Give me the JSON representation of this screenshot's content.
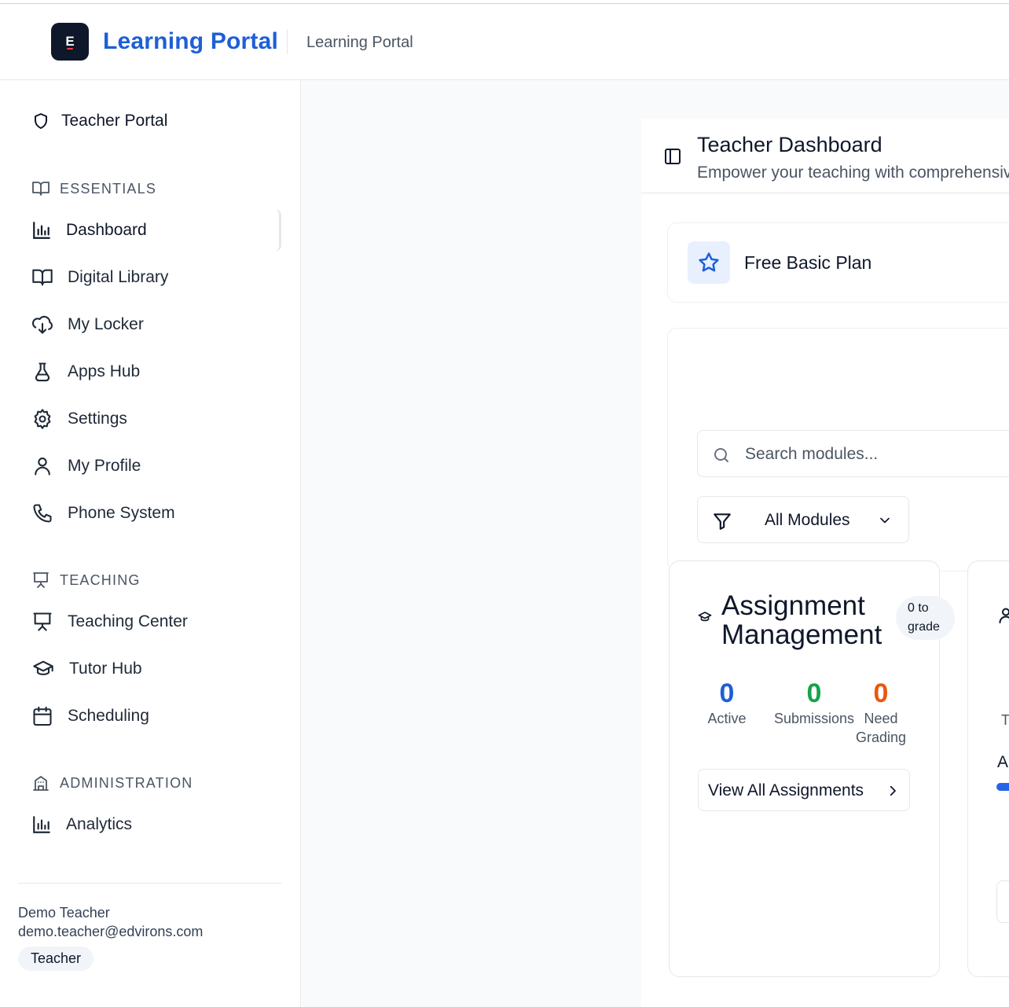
{
  "header": {
    "logo_letter": "E",
    "app_title": "Learning Portal",
    "breadcrumb": "Learning Portal"
  },
  "sidebar": {
    "portal_label": "Teacher Portal",
    "sections": {
      "essentials": "ESSENTIALS",
      "teaching": "TEACHING",
      "administration": "ADMINISTRATION"
    },
    "items": [
      {
        "label": "Dashboard",
        "icon": "bar-chart-icon"
      },
      {
        "label": "Digital Library",
        "icon": "book-open-icon"
      },
      {
        "label": "My Locker",
        "icon": "cloud-download-icon"
      },
      {
        "label": "Apps Hub",
        "icon": "flask-icon"
      },
      {
        "label": "Settings",
        "icon": "gear-icon"
      },
      {
        "label": "My Profile",
        "icon": "user-icon"
      },
      {
        "label": "Phone System",
        "icon": "phone-icon"
      },
      {
        "label": "Teaching Center",
        "icon": "presentation-icon"
      },
      {
        "label": "Tutor Hub",
        "icon": "graduation-cap-icon"
      },
      {
        "label": "Scheduling",
        "icon": "calendar-icon"
      },
      {
        "label": "Analytics",
        "icon": "bar-chart-icon"
      }
    ],
    "user": {
      "name": "Demo Teacher",
      "email": "demo.teacher@edvirons.com",
      "role": "Teacher"
    }
  },
  "panel": {
    "title": "Teacher Dashboard",
    "subtitle": "Empower your teaching with comprehensiv",
    "plan": "Free Basic Plan",
    "search_placeholder": "Search modules...",
    "filter_selected": "All Modules"
  },
  "assignments": {
    "title_line1": "Assignment",
    "title_line2": "Management",
    "badge_line1": "0 to",
    "badge_line2": "grade",
    "stats": [
      {
        "value": "0",
        "label": "Active",
        "color": "#1d5fd8"
      },
      {
        "value": "0",
        "label": "Submissions",
        "color": "#16a34a"
      },
      {
        "value": "0",
        "label_line1": "Need",
        "label_line2": "Grading",
        "color": "#ea580c"
      }
    ],
    "view_all": "View All Assignments"
  },
  "second_card": {
    "text_a": "T",
    "text_b": "A"
  },
  "colors": {
    "accent": "#1d5fd8",
    "green": "#16a34a",
    "orange": "#ea580c"
  }
}
